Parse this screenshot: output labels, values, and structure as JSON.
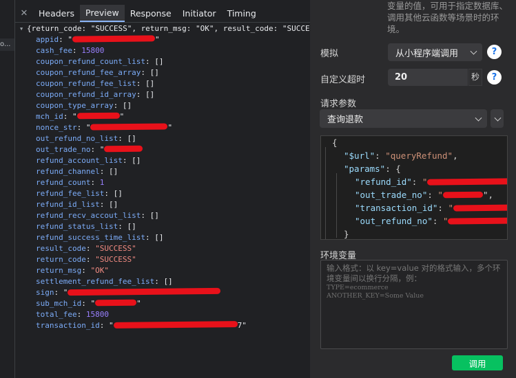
{
  "left_fragment": "o...",
  "devtools": {
    "tabs": [
      "Headers",
      "Preview",
      "Response",
      "Initiator",
      "Timing"
    ],
    "active_tab": "Preview",
    "root_line": "{return_code: \"SUCCESS\", return_msg: \"OK\", result_code: \"SUCCESS\"",
    "fields": [
      {
        "key": "appid",
        "parts": [
          {
            "t": "p",
            "v": "\""
          },
          {
            "t": "red",
            "w": 120
          },
          {
            "t": "p",
            "v": "\""
          }
        ]
      },
      {
        "key": "cash_fee",
        "parts": [
          {
            "t": "n",
            "v": "15800"
          }
        ]
      },
      {
        "key": "coupon_refund_count_list",
        "parts": [
          {
            "t": "p",
            "v": "[]"
          }
        ]
      },
      {
        "key": "coupon_refund_fee_array",
        "parts": [
          {
            "t": "p",
            "v": "[]"
          }
        ]
      },
      {
        "key": "coupon_refund_fee_list",
        "parts": [
          {
            "t": "p",
            "v": "[]"
          }
        ]
      },
      {
        "key": "coupon_refund_id_array",
        "parts": [
          {
            "t": "p",
            "v": "[]"
          }
        ]
      },
      {
        "key": "coupon_type_array",
        "parts": [
          {
            "t": "p",
            "v": "[]"
          }
        ]
      },
      {
        "key": "mch_id",
        "parts": [
          {
            "t": "p",
            "v": "\""
          },
          {
            "t": "red",
            "w": 62
          },
          {
            "t": "p",
            "v": "\""
          }
        ]
      },
      {
        "key": "nonce_str",
        "parts": [
          {
            "t": "p",
            "v": "\""
          },
          {
            "t": "red",
            "w": 112
          },
          {
            "t": "p",
            "v": "\""
          }
        ]
      },
      {
        "key": "out_refund_no_list",
        "parts": [
          {
            "t": "p",
            "v": "[]"
          }
        ]
      },
      {
        "key": "out_trade_no",
        "parts": [
          {
            "t": "p",
            "v": "\""
          },
          {
            "t": "red",
            "w": 56
          }
        ]
      },
      {
        "key": "refund_account_list",
        "parts": [
          {
            "t": "p",
            "v": "[]"
          }
        ]
      },
      {
        "key": "refund_channel",
        "parts": [
          {
            "t": "p",
            "v": "[]"
          }
        ]
      },
      {
        "key": "refund_count",
        "parts": [
          {
            "t": "n",
            "v": "1"
          }
        ]
      },
      {
        "key": "refund_fee_list",
        "parts": [
          {
            "t": "p",
            "v": "[]"
          }
        ]
      },
      {
        "key": "refund_id_list",
        "parts": [
          {
            "t": "p",
            "v": "[]"
          }
        ]
      },
      {
        "key": "refund_recv_accout_list",
        "parts": [
          {
            "t": "p",
            "v": "[]"
          }
        ]
      },
      {
        "key": "refund_status_list",
        "parts": [
          {
            "t": "p",
            "v": "[]"
          }
        ]
      },
      {
        "key": "refund_success_time_list",
        "parts": [
          {
            "t": "p",
            "v": "[]"
          }
        ]
      },
      {
        "key": "result_code",
        "parts": [
          {
            "t": "s",
            "v": "\"SUCCESS\""
          }
        ]
      },
      {
        "key": "return_code",
        "parts": [
          {
            "t": "s",
            "v": "\"SUCCESS\""
          }
        ]
      },
      {
        "key": "return_msg",
        "parts": [
          {
            "t": "s",
            "v": "\"OK\""
          }
        ]
      },
      {
        "key": "settlement_refund_fee_list",
        "parts": [
          {
            "t": "p",
            "v": "[]"
          }
        ]
      },
      {
        "key": "sign",
        "parts": [
          {
            "t": "p",
            "v": "\""
          },
          {
            "t": "red",
            "w": 222
          }
        ]
      },
      {
        "key": "sub_mch_id",
        "parts": [
          {
            "t": "p",
            "v": "\""
          },
          {
            "t": "red",
            "w": 60
          },
          {
            "t": "p",
            "v": "\""
          }
        ]
      },
      {
        "key": "total_fee",
        "parts": [
          {
            "t": "n",
            "v": "15800"
          }
        ]
      },
      {
        "key": "transaction_id",
        "parts": [
          {
            "t": "p",
            "v": "\""
          },
          {
            "t": "red",
            "w": 180
          },
          {
            "t": "p",
            "v": "7\""
          }
        ]
      }
    ]
  },
  "panel": {
    "top_note": "变量的值，可用于指定数据库、调用其他云函数等场景时的环境。",
    "simulate_label": "模拟",
    "simulate_value": "从小程序端调用",
    "timeout_label": "自定义超时",
    "timeout_value": "20",
    "timeout_unit": "秒",
    "params_label": "请求参数",
    "params_select": "查询退款",
    "help_glyph": "?",
    "code_open": "{",
    "code_url_key": "\"$url\"",
    "code_url_val": "\"queryRefund\"",
    "code_params_key": "\"params\"",
    "code_refund_id": "\"refund_id\"",
    "code_out_trade_no": "\"out_trade_no\"",
    "code_transaction_id": "\"transaction_id\"",
    "code_out_refund_no": "\"out_refund_no\"",
    "code_close": "}",
    "env_label": "环境变量",
    "env_placeholder_1": "输入格式：以 key=value 对的格式输入，多个环境变量间以换行分隔，例：",
    "env_placeholder_2": "TYPE=ecommerce",
    "env_placeholder_3": "ANOTHER_KEY=Some Value",
    "call_button": "调用"
  },
  "colors": {
    "accent_green": "#07c160",
    "redaction": "#e8111a",
    "json_key": "#7cacf8",
    "json_string": "#f28b82",
    "json_number": "#9980ff"
  }
}
